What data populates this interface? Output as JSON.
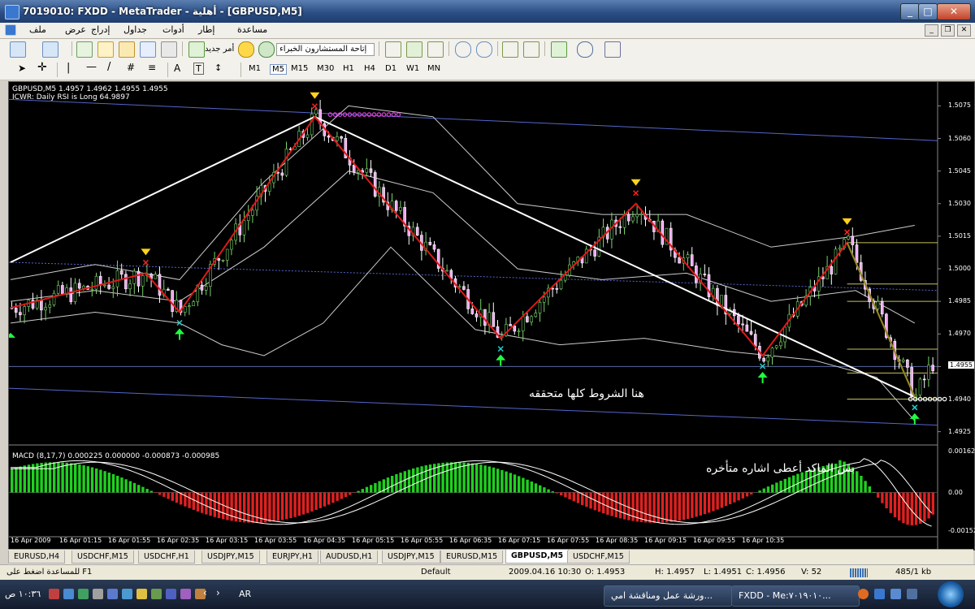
{
  "window": {
    "title": "7019010: FXDD - MetaTrader - أهلية - [GBPUSD,M5]"
  },
  "menu": {
    "items": [
      "ملف",
      "عرض",
      "إدراج",
      "جداول",
      "أدوات",
      "إطار",
      "مساعدة"
    ]
  },
  "toolbar": {
    "new_order": "أمر جديد",
    "experts": "إتاحة المستشارون الخبراء"
  },
  "timeframes": [
    "M1",
    "M5",
    "M15",
    "M30",
    "H1",
    "H4",
    "D1",
    "W1",
    "MN"
  ],
  "chart": {
    "header_line1": "GBPUSD,M5  1.4957 1.4962 1.4955 1.4955",
    "header_line2": "ICWR: Daily RSI is Long 64.9897",
    "annotation_main": "هنا الشروط كلها متحققه",
    "macd_header": "MACD (8,17,7) 0.000225 0.000000 -0.000873 -0.000985",
    "annotation_macd": "بس الماكد أعطى اشاره متأخره",
    "current_price": "1.4955"
  },
  "chart_data": {
    "type": "candlestick",
    "symbol": "GBPUSD",
    "timeframe": "M5",
    "price_axis_labels": [
      "1.5075",
      "1.5060",
      "1.5045",
      "1.5030",
      "1.5015",
      "1.5000",
      "1.4985",
      "1.4970",
      "1.4955",
      "1.4940",
      "1.4925"
    ],
    "ylim": [
      1.492,
      1.5083
    ],
    "time_labels": [
      "16 Apr 2009",
      "16 Apr 01:15",
      "16 Apr 01:55",
      "16 Apr 02:35",
      "16 Apr 03:15",
      "16 Apr 03:55",
      "16 Apr 04:35",
      "16 Apr 05:15",
      "16 Apr 05:55",
      "16 Apr 06:35",
      "16 Apr 07:15",
      "16 Apr 07:55",
      "16 Apr 08:35",
      "16 Apr 09:15",
      "16 Apr 09:55",
      "16 Apr 10:35"
    ],
    "zigzag": [
      [
        0,
        1.4982
      ],
      [
        32,
        1.4998
      ],
      [
        40,
        1.498
      ],
      [
        72,
        1.507
      ],
      [
        116,
        1.4968
      ],
      [
        148,
        1.503
      ],
      [
        178,
        1.496
      ],
      [
        198,
        1.5012
      ],
      [
        214,
        1.4941
      ]
    ],
    "white_lines": [
      [
        [
          0,
          1.5003
        ],
        [
          72,
          1.507
        ]
      ],
      [
        [
          72,
          1.507
        ],
        [
          214,
          1.4941
        ]
      ]
    ],
    "up_arrows": [
      40,
      116,
      178,
      214
    ],
    "down_arrows": [
      32,
      72,
      148,
      198
    ],
    "macd_axis_labels": [
      "0.001626",
      "0.00",
      "-0.00152"
    ],
    "macd_ylim": [
      -0.00175,
      0.00185
    ]
  },
  "tabs": [
    "EURUSD,H4",
    "USDCHF,M15",
    "USDCHF,H1",
    "USDJPY,M15",
    "EURJPY,H1",
    "AUDUSD,H1",
    "USDJPY,M15",
    "EURUSD,M15",
    "GBPUSD,M5",
    "USDCHF,M15"
  ],
  "active_tab": "GBPUSD,M5",
  "status": {
    "help": "للمساعدة اضغط على F1",
    "profile": "Default",
    "datetime": "2009.04.16 10:30",
    "open": "O: 1.4953",
    "high": "H: 1.4957",
    "low": "L: 1.4951",
    "close": "C: 1.4956",
    "volume": "V: 52",
    "traffic": "485/1 kb"
  },
  "taskbar": {
    "clock": "١٠:٣٦ ص",
    "lang": "AR",
    "task1": "ورشة عمل ومناقشة امي...",
    "task2": "FXDD - Me:٧٠١٩٠١٠..."
  }
}
